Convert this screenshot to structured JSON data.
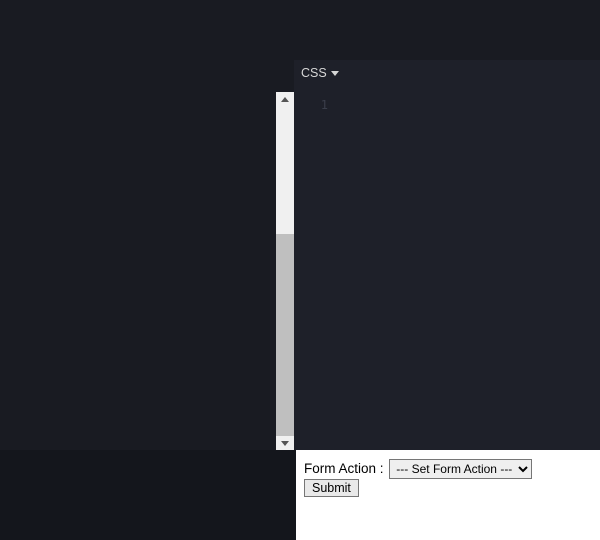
{
  "editor": {
    "tab_label": "CSS",
    "line_number": "1"
  },
  "form": {
    "label": "Form Action :",
    "select_placeholder": "--- Set Form Action ---",
    "submit_label": "Submit"
  }
}
